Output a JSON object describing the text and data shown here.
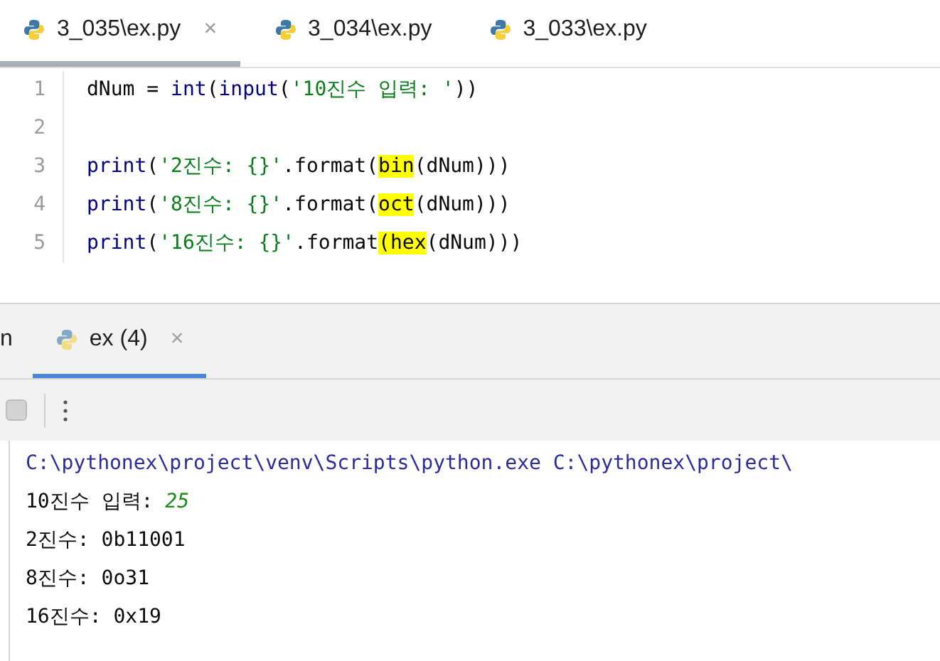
{
  "editor_tabs": [
    {
      "label": "3_035\\ex.py",
      "selected": true,
      "close": "×"
    },
    {
      "label": "3_034\\ex.py",
      "selected": false
    },
    {
      "label": "3_033\\ex.py",
      "selected": false
    }
  ],
  "code_lines": [
    {
      "number": "1",
      "tokens": [
        {
          "text": "dNum = ",
          "kind": "plain"
        },
        {
          "text": "int",
          "kind": "builtin"
        },
        {
          "text": "(",
          "kind": "plain"
        },
        {
          "text": "input",
          "kind": "builtin"
        },
        {
          "text": "(",
          "kind": "plain"
        },
        {
          "text": "'10진수 입력: '",
          "kind": "string"
        },
        {
          "text": "))",
          "kind": "plain"
        }
      ]
    },
    {
      "number": "2"
    },
    {
      "number": "3",
      "tokens": [
        {
          "text": "print",
          "kind": "builtin"
        },
        {
          "text": "(",
          "kind": "plain"
        },
        {
          "text": "'2진수: {}'",
          "kind": "string"
        },
        {
          "text": ".format(",
          "kind": "plain"
        },
        {
          "text": "bin",
          "kind": "highlight"
        },
        {
          "text": "(dNum)))",
          "kind": "plain"
        }
      ]
    },
    {
      "number": "4",
      "tokens": [
        {
          "text": "print",
          "kind": "builtin"
        },
        {
          "text": "(",
          "kind": "plain"
        },
        {
          "text": "'8진수: {}'",
          "kind": "string"
        },
        {
          "text": ".format(",
          "kind": "plain"
        },
        {
          "text": "oct",
          "kind": "highlight"
        },
        {
          "text": "(dNum)))",
          "kind": "plain"
        }
      ]
    },
    {
      "number": "5",
      "tokens": [
        {
          "text": "print",
          "kind": "builtin"
        },
        {
          "text": "(",
          "kind": "plain"
        },
        {
          "text": "'16진수: {}'",
          "kind": "string"
        },
        {
          "text": ".format",
          "kind": "plain"
        },
        {
          "text": "(hex",
          "kind": "highlight"
        },
        {
          "text": "(dNum)))",
          "kind": "plain"
        }
      ]
    }
  ],
  "tool_tabs": [
    {
      "label": "n",
      "selected": false,
      "icon": false
    },
    {
      "label": "ex (4)",
      "selected": true,
      "icon": true,
      "close": "×"
    }
  ],
  "toolbar": {
    "stop_disabled": true
  },
  "console_lines": [
    {
      "parts": [
        {
          "text": "C:\\pythonex\\project\\venv\\Scripts\\python.exe C:\\pythonex\\project\\",
          "kind": "command"
        }
      ]
    },
    {
      "parts": [
        {
          "text": "10진수 입력: ",
          "kind": "output"
        },
        {
          "text": "25",
          "kind": "input"
        }
      ]
    },
    {
      "parts": [
        {
          "text": "2진수: 0b11001",
          "kind": "output"
        }
      ]
    },
    {
      "parts": [
        {
          "text": "8진수: 0o31",
          "kind": "output"
        }
      ]
    },
    {
      "parts": [
        {
          "text": "16진수: 0x19",
          "kind": "output"
        }
      ]
    }
  ]
}
